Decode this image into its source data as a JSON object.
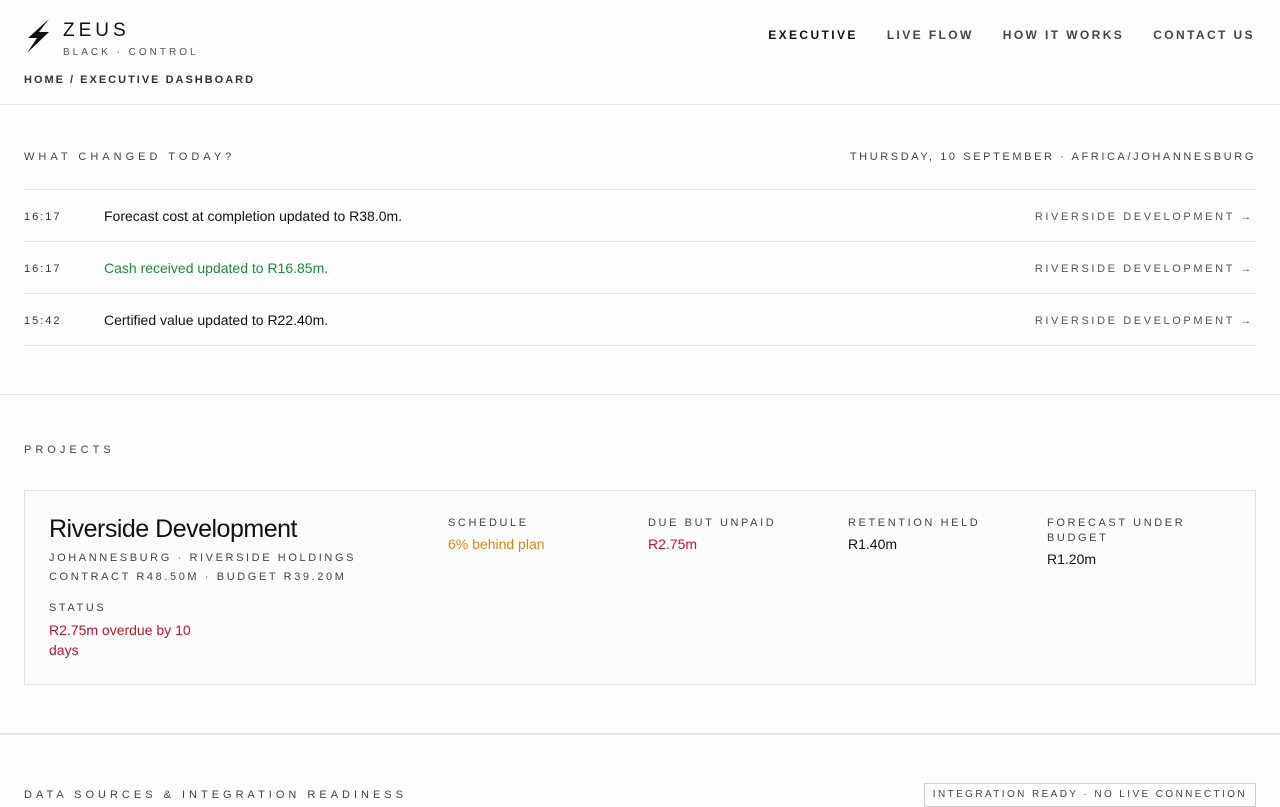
{
  "brand": {
    "name": "ZEUS",
    "tagline": "BLACK · CONTROL"
  },
  "nav": [
    {
      "label": "EXECUTIVE",
      "active": true
    },
    {
      "label": "LIVE FLOW",
      "active": false
    },
    {
      "label": "HOW IT WORKS",
      "active": false
    },
    {
      "label": "CONTACT US",
      "active": false
    }
  ],
  "breadcrumb": "HOME / EXECUTIVE DASHBOARD",
  "changes": {
    "title": "WHAT CHANGED TODAY?",
    "date": "THURSDAY, 10 SEPTEMBER · AFRICA/JOHANNESBURG",
    "items": [
      {
        "time": "16:17",
        "text": "Forecast cost at completion updated to R38.0m.",
        "project": "RIVERSIDE DEVELOPMENT →"
      },
      {
        "time": "16:17",
        "text": "Cash received updated to R16.85m.",
        "project": "RIVERSIDE DEVELOPMENT →"
      },
      {
        "time": "15:42",
        "text": "Certified value updated to R22.40m.",
        "project": "RIVERSIDE DEVELOPMENT →"
      }
    ]
  },
  "projects": {
    "title": "PROJECTS",
    "card": {
      "name": "Riverside Development",
      "meta_1": "JOHANNESBURG · RIVERSIDE HOLDINGS",
      "meta_2": "CONTRACT R48.50M · BUDGET R39.20M",
      "status_label": "STATUS",
      "status_value": "R2.75m overdue by 10 days",
      "metrics": [
        {
          "label": "SCHEDULE",
          "value": "6% behind plan"
        },
        {
          "label": "DUE BUT UNPAID",
          "value": "R2.75m"
        },
        {
          "label": "RETENTION HELD",
          "value": "R1.40m"
        },
        {
          "label": "FORECAST UNDER BUDGET",
          "value": "R1.20m"
        }
      ]
    }
  },
  "sources": {
    "title": "DATA SOURCES & INTEGRATION READINESS",
    "badge": "INTEGRATION READY · NO LIVE CONNECTION"
  },
  "colors": {
    "positive": "#1c8a3a",
    "warning": "#d88a0e",
    "negative": "#c0142b"
  },
  "icons": {
    "logo": "lightning-bolt-icon"
  }
}
